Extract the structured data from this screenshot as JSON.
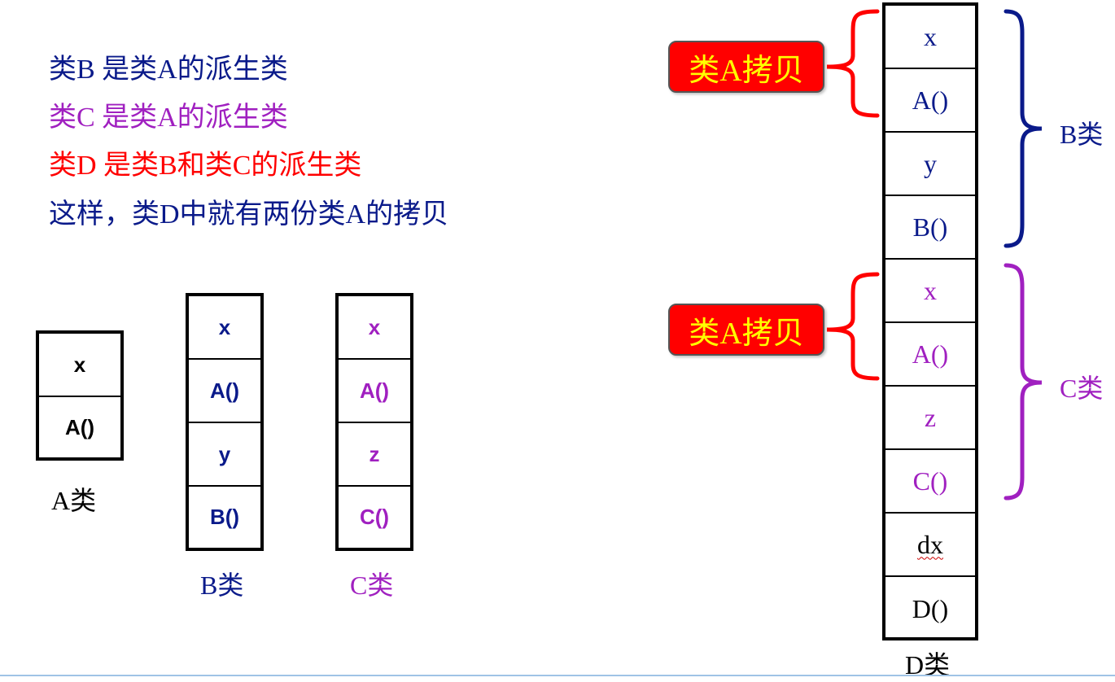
{
  "colors": {
    "navy": "#0a1a8a",
    "purple": "#a020c0",
    "red": "#ff0000",
    "black": "#000000",
    "badge_bg": "#ff0000",
    "badge_text": "#ffff00"
  },
  "statements": [
    "类B  是类A的派生类",
    "类C  是类A的派生类",
    "类D  是类B和类C的派生类",
    "这样，类D中就有两份类A的拷贝"
  ],
  "class_a": {
    "cells": [
      "x",
      "A()"
    ],
    "caption": "A类"
  },
  "class_b": {
    "cells": [
      "x",
      "A()",
      "y",
      "B()"
    ],
    "caption": "B类"
  },
  "class_c": {
    "cells": [
      "x",
      "A()",
      "z",
      "C()"
    ],
    "caption": "C类"
  },
  "class_d": {
    "cells": [
      "x",
      "A()",
      "y",
      "B()",
      "x",
      "A()",
      "z",
      "C()",
      "dx",
      "D()"
    ],
    "caption": "D类"
  },
  "annotations": {
    "copy_label_1": "类A拷贝",
    "copy_label_2": "类A拷贝",
    "b_group_label": "B类",
    "c_group_label": "C类"
  }
}
